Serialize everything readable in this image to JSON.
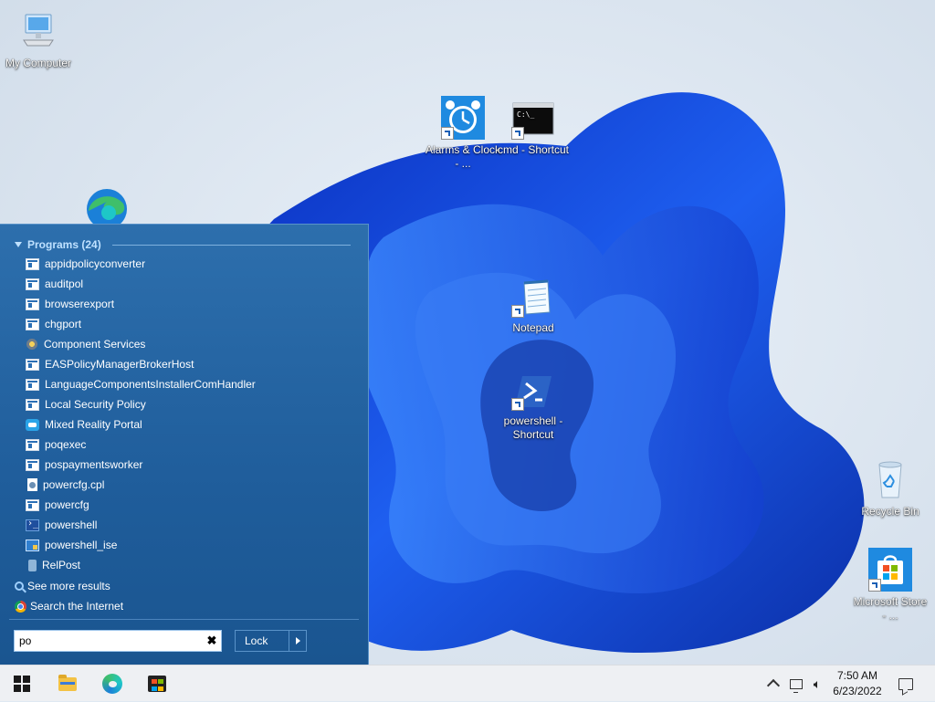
{
  "desktop": {
    "icons": [
      {
        "label": "My Computer",
        "icon": "computer-icon"
      },
      {
        "label": "Alarms & Clock - ...",
        "icon": "alarm-clock-icon"
      },
      {
        "label": "cmd - Shortcut",
        "icon": "cmd-icon"
      },
      {
        "label": "Notepad",
        "icon": "notepad-icon"
      },
      {
        "label": "powershell - Shortcut",
        "icon": "powershell-icon"
      },
      {
        "label": "Recycle Bin",
        "icon": "recycle-bin-icon"
      },
      {
        "label": "Microsoft Store - ...",
        "icon": "store-icon"
      },
      {
        "label": "",
        "icon": "edge-icon"
      }
    ]
  },
  "start_menu": {
    "section_title": "Programs (24)",
    "programs": [
      {
        "label": "appidpolicyconverter",
        "icon": "app-window-icon"
      },
      {
        "label": "auditpol",
        "icon": "app-window-icon"
      },
      {
        "label": "browserexport",
        "icon": "app-window-icon"
      },
      {
        "label": "chgport",
        "icon": "app-window-icon"
      },
      {
        "label": "Component Services",
        "icon": "component-services-icon"
      },
      {
        "label": "EASPolicyManagerBrokerHost",
        "icon": "app-window-icon"
      },
      {
        "label": "LanguageComponentsInstallerComHandler",
        "icon": "app-window-icon"
      },
      {
        "label": "Local Security Policy",
        "icon": "security-policy-icon"
      },
      {
        "label": "Mixed Reality Portal",
        "icon": "mixed-reality-icon"
      },
      {
        "label": "poqexec",
        "icon": "app-window-icon"
      },
      {
        "label": "pospaymentsworker",
        "icon": "app-window-icon"
      },
      {
        "label": "powercfg.cpl",
        "icon": "control-panel-file-icon"
      },
      {
        "label": "powercfg",
        "icon": "app-window-icon"
      },
      {
        "label": "powershell",
        "icon": "powershell-icon"
      },
      {
        "label": "powershell_ise",
        "icon": "powershell-ise-icon"
      },
      {
        "label": "RelPost",
        "icon": "relpost-icon"
      }
    ],
    "see_more": "See more results",
    "search_internet": "Search the Internet",
    "search": {
      "value": "po"
    },
    "power_button": "Lock"
  },
  "taskbar": {
    "apps": [
      "start-icon",
      "file-explorer-icon",
      "edge-icon",
      "store-icon"
    ],
    "time": "7:50 AM",
    "date": "6/23/2022"
  },
  "colors": {
    "start_menu_bg": "#1f5d9b",
    "section_header": "#bfe1ff",
    "taskbar_bg": "#eef0f3"
  }
}
